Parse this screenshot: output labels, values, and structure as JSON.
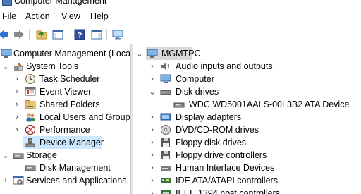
{
  "window": {
    "title": "Computer Management"
  },
  "menu": [
    "File",
    "Action",
    "View",
    "Help"
  ],
  "left_tree": {
    "root": "Computer Management (Local",
    "items": [
      {
        "label": "System Tools",
        "level": 1,
        "expanded": true
      },
      {
        "label": "Task Scheduler",
        "level": 2,
        "expanded": false
      },
      {
        "label": "Event Viewer",
        "level": 2,
        "expanded": false
      },
      {
        "label": "Shared Folders",
        "level": 2,
        "expanded": false
      },
      {
        "label": "Local Users and Groups",
        "level": 2,
        "expanded": false
      },
      {
        "label": "Performance",
        "level": 2,
        "expanded": false
      },
      {
        "label": "Device Manager",
        "level": 2,
        "selected": true
      },
      {
        "label": "Storage",
        "level": 1,
        "expanded": true
      },
      {
        "label": "Disk Management",
        "level": 2
      },
      {
        "label": "Services and Applications",
        "level": 1,
        "expanded": false
      }
    ]
  },
  "device_tree": {
    "root": "MGMTPC",
    "items": [
      {
        "label": "Audio inputs and outputs",
        "icon": "speaker-icon"
      },
      {
        "label": "Computer",
        "icon": "monitor-icon"
      },
      {
        "label": "Disk drives",
        "icon": "disk-icon",
        "expanded": true
      },
      {
        "label": "WDC WD5001AALS-00L3B2 ATA Device",
        "icon": "disk-icon",
        "child": true
      },
      {
        "label": "Display adapters",
        "icon": "display-adapter-icon"
      },
      {
        "label": "DVD/CD-ROM drives",
        "icon": "dvd-icon"
      },
      {
        "label": "Floppy disk drives",
        "icon": "floppy-icon"
      },
      {
        "label": "Floppy drive controllers",
        "icon": "floppy-controller-icon"
      },
      {
        "label": "Human Interface Devices",
        "icon": "hid-icon"
      },
      {
        "label": "IDE ATA/ATAPI controllers",
        "icon": "ide-icon"
      },
      {
        "label": "IEEE 1394 host controllers",
        "icon": "ieee1394-icon"
      }
    ]
  }
}
